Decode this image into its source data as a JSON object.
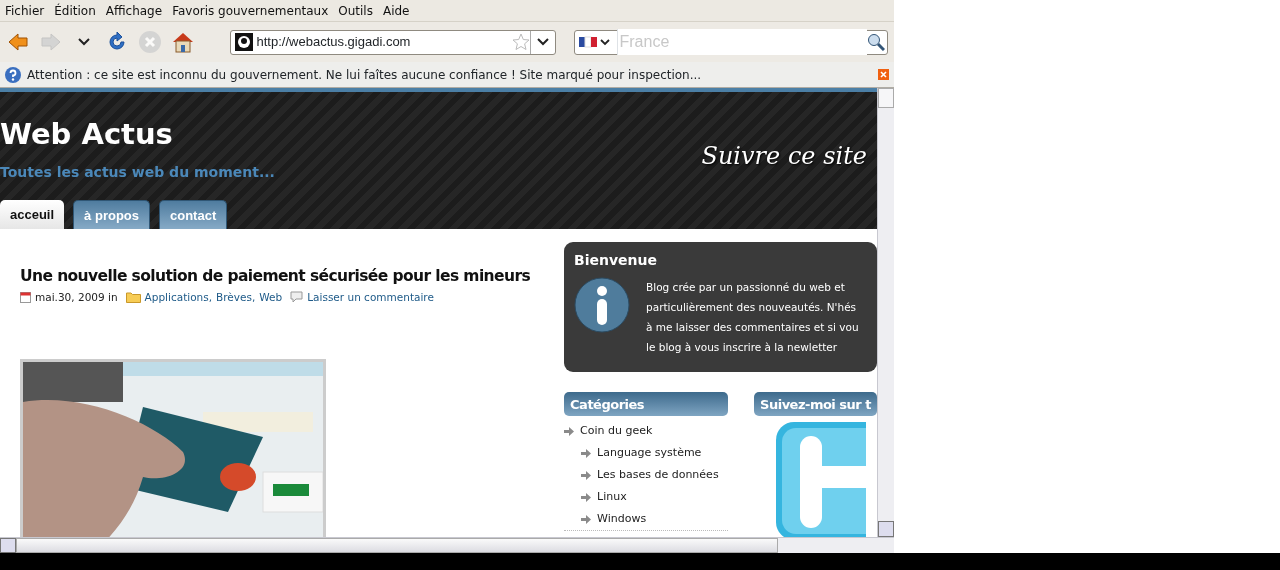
{
  "menu_bar": [
    "Fichier",
    "Édition",
    "Affichage",
    "Favoris gouvernementaux",
    "Outils",
    "Aide"
  ],
  "toolbar": {
    "buttons": [
      {
        "kind": "back",
        "disabled": false
      },
      {
        "kind": "forward",
        "disabled": true
      },
      {
        "kind": "history",
        "disabled": false
      },
      {
        "kind": "reload",
        "disabled": false
      },
      {
        "kind": "stop",
        "disabled": true
      },
      {
        "kind": "home",
        "disabled": false
      }
    ],
    "address": "http://webactus.gigadi.com",
    "search": {
      "placeholder": "France"
    }
  },
  "notification": {
    "text": "Attention : ce site est inconnu du gouvernement. Ne lui faîtes aucune confiance ! Site marqué pour inspection..."
  },
  "site": {
    "title": "Web Actus",
    "tagline": "Toutes les actus web du moment...",
    "follow": "Suivre ce site",
    "tabs": [
      {
        "label": "acceuil",
        "selected": true
      },
      {
        "label": "à propos",
        "selected": false
      },
      {
        "label": "contact",
        "selected": false
      }
    ]
  },
  "post": {
    "title": "Une nouvelle solution de paiement sécurisée pour les mineurs",
    "date": "mai.30, 2009",
    "in": "in",
    "categories": [
      "Applications,",
      "Brèves,",
      "Web"
    ],
    "comment_link": "Laisser un commentaire",
    "image": {
      "kind": "picture"
    }
  },
  "welcome": {
    "title": "Bienvenue",
    "lines": [
      "Blog crée par un passionné du web et",
      "particulièrement des nouveautés. N'hés",
      "à me laisser des commentaires et si vou",
      "le blog à vous inscrire à la newletter"
    ]
  },
  "categories": {
    "title": "Catégories",
    "items": [
      {
        "label": "Coin du geek",
        "children": [
          {
            "label": "Language système"
          },
          {
            "label": "Les bases de données"
          },
          {
            "label": "Linux"
          },
          {
            "label": "Windows"
          }
        ]
      }
    ]
  },
  "follow_widget": {
    "title": "Suivez-moi sur t"
  }
}
